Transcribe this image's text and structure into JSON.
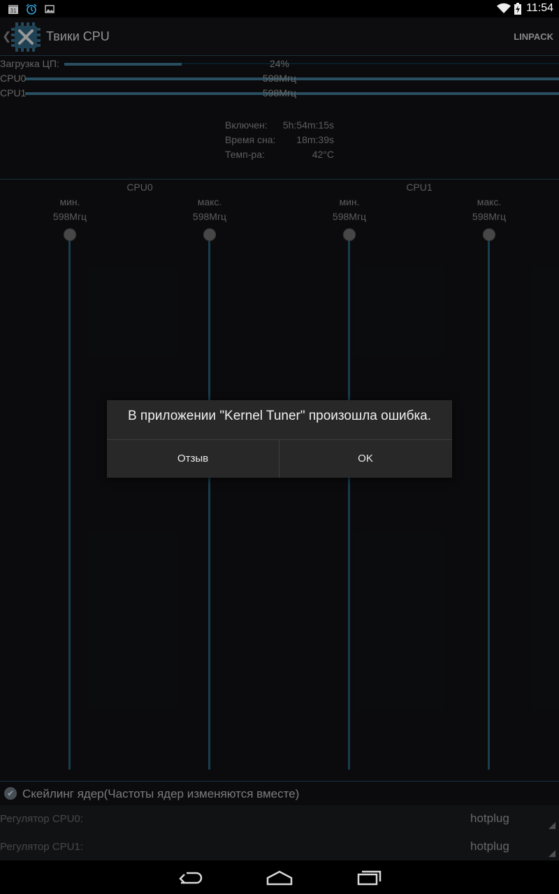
{
  "status_bar": {
    "time": "11:54",
    "left_icons": [
      "calendar-icon",
      "alarm-icon",
      "image-icon"
    ],
    "calendar_day": "31",
    "right_icons": [
      "wifi-icon",
      "battery-icon"
    ]
  },
  "action_bar": {
    "title": "Твики CPU",
    "action": "LINPACK"
  },
  "load": {
    "label": "Загрузка ЦП:",
    "value": "24%",
    "fraction": 0.24
  },
  "cpu_rows": [
    {
      "label": "CPU0",
      "value": "598Мгц",
      "fraction": 1.0
    },
    {
      "label": "CPU1",
      "value": "598Мгц",
      "fraction": 1.0
    }
  ],
  "stats": {
    "uptime_label": "Включен:",
    "uptime_value": "5h:54m:15s",
    "deep_sleep_label": "Время сна:",
    "deep_sleep_value": "18m:39s",
    "temp_label": "Темп-ра:",
    "temp_value": "42°C"
  },
  "frequency": {
    "cpu0_title": "CPU0",
    "cpu1_title": "CPU1",
    "columns": [
      {
        "label": "мин.",
        "value": "598Мгц",
        "level": 1.0
      },
      {
        "label": "макс.",
        "value": "598Мгц",
        "level": 1.0
      },
      {
        "label": "мин.",
        "value": "598Мгц",
        "level": 1.0
      },
      {
        "label": "макс.",
        "value": "598Мгц",
        "level": 1.0
      }
    ]
  },
  "scaling": {
    "label": "Скейлинг ядер(Частоты ядер изменяются вместе)",
    "checked": true
  },
  "governors": [
    {
      "label": "Регулятор CPU0:",
      "value": "hotplug"
    },
    {
      "label": "Регулятор CPU1:",
      "value": "hotplug"
    }
  ],
  "dialog": {
    "message": "В приложении \"Kernel Tuner\" произошла ошибка.",
    "report_button": "Отзыв",
    "ok_button": "OK"
  },
  "navigation": [
    "back-icon",
    "home-icon",
    "recent-apps-icon"
  ],
  "colors": {
    "accent": "#3f7894",
    "slider_track": "#245f78",
    "background": "#111214"
  }
}
